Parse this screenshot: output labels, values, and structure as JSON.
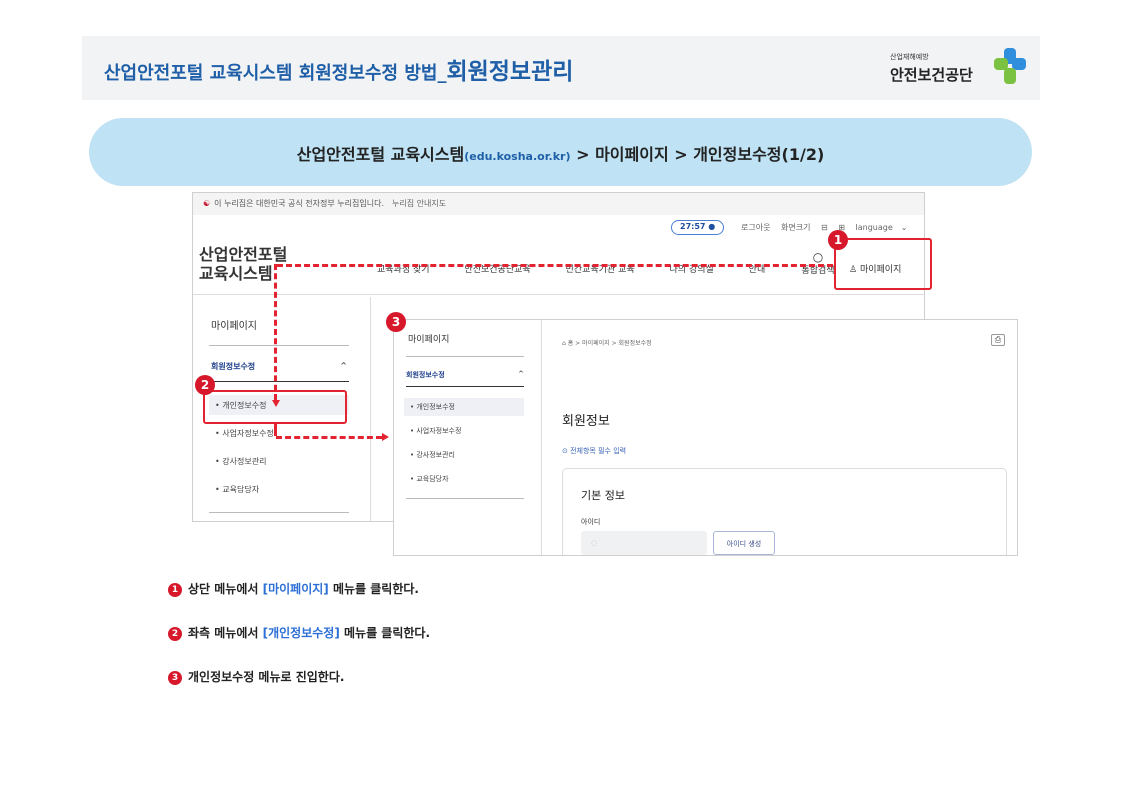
{
  "header": {
    "title_main": "산업안전포털 교육시스템 회원정보수정 방법_",
    "title_emph": "회원정보관리",
    "brand_small": "산업재해예방",
    "brand_name": "안전보건공단"
  },
  "banner": {
    "part1": "산업안전포털 교육시스템",
    "domain": "(edu.kosha.or.kr)",
    "part2": " > 마이페이지 > 개인정보수정(1/2)"
  },
  "portal": {
    "gov_notice": "이 누리집은 대한민국 공식 전자정부 누리집입니다.",
    "gov_link": "누리집 안내지도",
    "timer": "27:57",
    "logout": "로그아웃",
    "font_size": "화면크기",
    "language": "language",
    "logo_line1": "산업안전포털",
    "logo_line2": "교육시스템",
    "nav": [
      "교육과정 찾기",
      "안전보건공단교육",
      "민간교육기관 교육",
      "나의 강의실",
      "안내"
    ],
    "search": "통합검색",
    "mypage": "마이페이지",
    "side_title": "마이페이지",
    "side_sub": "회원정보수정",
    "side_items": [
      "개인정보수정",
      "사업자정보수정",
      "강사정보관리",
      "교육담당자"
    ]
  },
  "detail": {
    "side_title": "마이페이지",
    "side_sub": "회원정보수정",
    "side_items": [
      "개인정보수정",
      "사업자정보수정",
      "강사정보관리",
      "교육담당자"
    ],
    "breadcrumb": "홈 > 마이페이지 > 회원정보수정",
    "page_title": "회원정보",
    "required": "전체항목 필수 입력",
    "card_title": "기본 정보",
    "id_label": "아이디",
    "id_button": "아이디 생성"
  },
  "badges": [
    "1",
    "2",
    "3"
  ],
  "steps": [
    {
      "num": "1",
      "pre": "상단 메뉴에서 ",
      "hi": "[마이페이지]",
      "post": " 메뉴를 클릭한다."
    },
    {
      "num": "2",
      "pre": "좌측 메뉴에서 ",
      "hi": "[개인정보수정]",
      "post": " 메뉴를 클릭한다."
    },
    {
      "num": "3",
      "pre": "개인정보수정 메뉴로 진입한다.",
      "hi": "",
      "post": ""
    }
  ],
  "colors": {
    "accent_red": "#e3232f",
    "title_blue": "#1f5fa8",
    "banner_bg": "#bfe3f4",
    "highlight_blue": "#2d6fd6"
  }
}
